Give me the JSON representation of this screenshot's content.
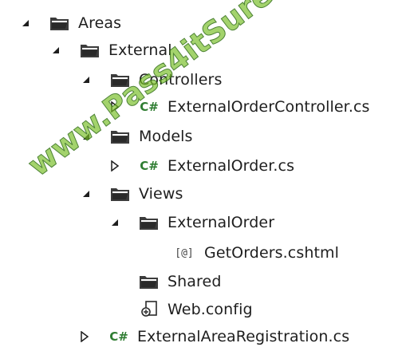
{
  "tree": {
    "areas": {
      "label": "Areas",
      "icon": "folder-icon",
      "state": "expanded"
    },
    "external": {
      "label": "External",
      "icon": "folder-icon",
      "state": "expanded"
    },
    "controllers": {
      "label": "Controllers",
      "icon": "folder-icon",
      "state": "expanded"
    },
    "external_order_controller": {
      "label": "ExternalOrderController.cs",
      "icon": "csharp-file-icon",
      "state": "collapsed"
    },
    "models": {
      "label": "Models",
      "icon": "folder-icon",
      "state": "expanded"
    },
    "external_order_model": {
      "label": "ExternalOrder.cs",
      "icon": "csharp-file-icon",
      "state": "collapsed"
    },
    "views": {
      "label": "Views",
      "icon": "folder-icon",
      "state": "expanded"
    },
    "external_order_view_folder": {
      "label": "ExternalOrder",
      "icon": "folder-icon",
      "state": "expanded"
    },
    "get_orders": {
      "label": "GetOrders.cshtml",
      "icon": "razor-file-icon",
      "badge": "[@]"
    },
    "shared": {
      "label": "Shared",
      "icon": "folder-icon"
    },
    "web_config": {
      "label": "Web.config",
      "icon": "config-file-icon"
    },
    "external_area_registration": {
      "label": "ExternalAreaRegistration.cs",
      "icon": "csharp-file-icon",
      "state": "collapsed"
    }
  },
  "badges": {
    "cs": "C#"
  },
  "watermark": {
    "text": "www.Pass4itSure.com"
  },
  "colors": {
    "text": "#1e1e1e",
    "folder": "#3c3c3c",
    "cs_badge": "#2f7d32",
    "watermark": "#78be28"
  }
}
